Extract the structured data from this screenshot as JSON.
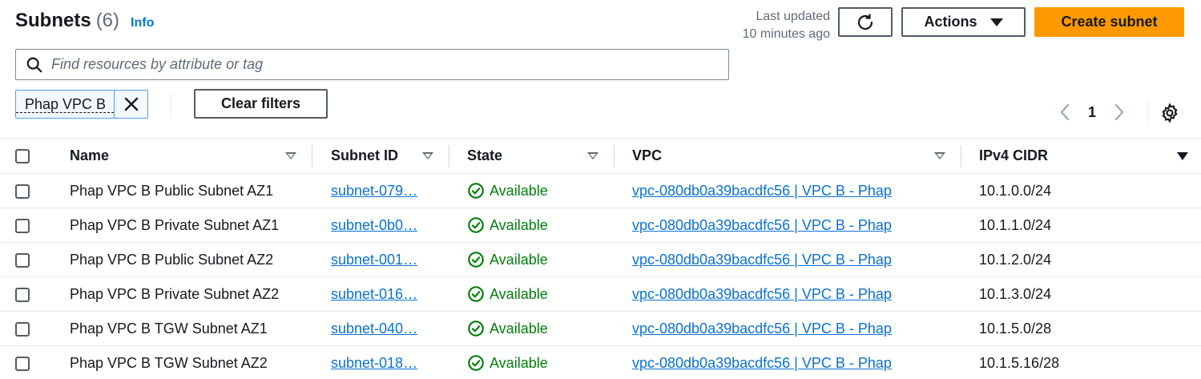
{
  "header": {
    "title": "Subnets",
    "count": "(6)",
    "info": "Info",
    "last_updated_line1": "Last updated",
    "last_updated_line2": "10 minutes ago",
    "actions_label": "Actions",
    "create_label": "Create subnet"
  },
  "search": {
    "placeholder": "Find resources by attribute or tag"
  },
  "filter_token": {
    "label": "Phap VPC B"
  },
  "clear_filters": "Clear filters",
  "pagination": {
    "current_page": "1"
  },
  "table": {
    "columns": [
      "Name",
      "Subnet ID",
      "State",
      "VPC",
      "IPv4 CIDR"
    ],
    "rows": [
      {
        "name": "Phap VPC B Public Subnet AZ1",
        "subnet_id": "subnet-079…",
        "state": "Available",
        "vpc": "vpc-080db0a39bacdfc56 | VPC B - Phap",
        "cidr": "10.1.0.0/24"
      },
      {
        "name": "Phap VPC B Private Subnet AZ1",
        "subnet_id": "subnet-0b0…",
        "state": "Available",
        "vpc": "vpc-080db0a39bacdfc56 | VPC B - Phap",
        "cidr": "10.1.1.0/24"
      },
      {
        "name": "Phap VPC B Public Subnet AZ2",
        "subnet_id": "subnet-001…",
        "state": "Available",
        "vpc": "vpc-080db0a39bacdfc56 | VPC B - Phap",
        "cidr": "10.1.2.0/24"
      },
      {
        "name": "Phap VPC B Private Subnet AZ2",
        "subnet_id": "subnet-016…",
        "state": "Available",
        "vpc": "vpc-080db0a39bacdfc56 | VPC B - Phap",
        "cidr": "10.1.3.0/24"
      },
      {
        "name": "Phap VPC B TGW Subnet AZ1",
        "subnet_id": "subnet-040…",
        "state": "Available",
        "vpc": "vpc-080db0a39bacdfc56 | VPC B - Phap",
        "cidr": "10.1.5.0/28"
      },
      {
        "name": "Phap VPC B TGW Subnet AZ2",
        "subnet_id": "subnet-018…",
        "state": "Available",
        "vpc": "vpc-080db0a39bacdfc56 | VPC B - Phap",
        "cidr": "10.1.5.16/28"
      }
    ]
  },
  "colors": {
    "primary_button": "#ff9900",
    "link": "#0972d3",
    "success": "#037f0c"
  }
}
